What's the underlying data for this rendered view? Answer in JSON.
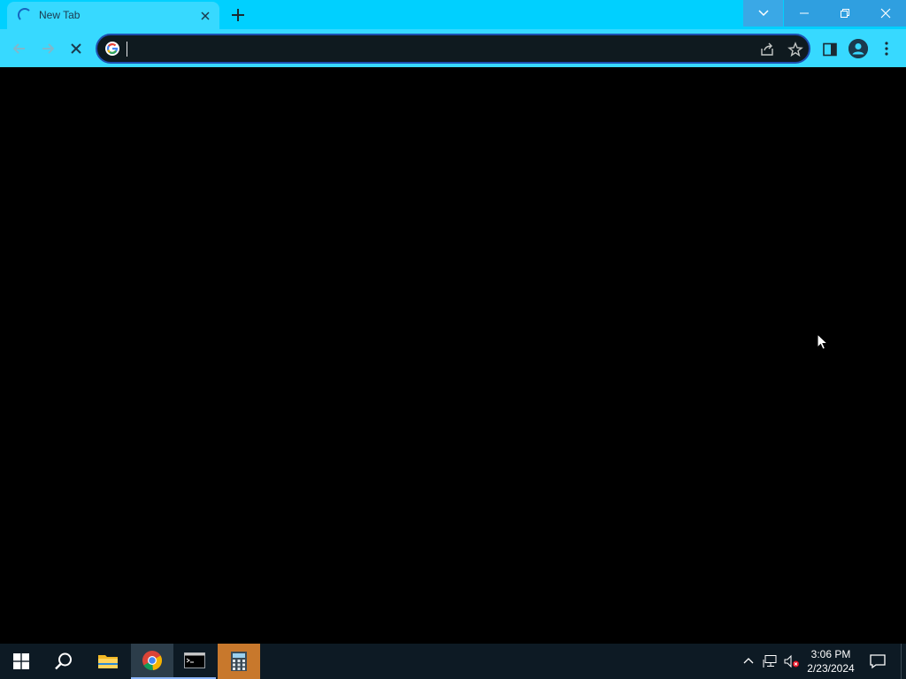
{
  "browser": {
    "tab": {
      "title": "New Tab"
    },
    "omnibox": {
      "value": "",
      "placeholder": ""
    }
  },
  "taskbar": {
    "clock": {
      "time": "3:06 PM",
      "date": "2/23/2024"
    }
  },
  "colors": {
    "titlebar": "#00d0ff",
    "toolbar": "#37d9ff",
    "omnibox_bg": "#0f1a1f",
    "omnibox_border": "#1e4fb0",
    "taskbar": "#0d1a24",
    "content": "#000000"
  },
  "icons": [
    "loading-spinner-icon",
    "close-icon",
    "plus-icon",
    "chevron-down-icon",
    "minimize-icon",
    "restore-icon",
    "close-window-icon",
    "back-arrow-icon",
    "forward-arrow-icon",
    "stop-icon",
    "google-icon",
    "share-icon",
    "star-icon",
    "side-panel-icon",
    "profile-icon",
    "kebab-menu-icon",
    "windows-start-icon",
    "search-icon",
    "file-explorer-icon",
    "chrome-icon",
    "terminal-icon",
    "calculator-icon",
    "chevron-up-icon",
    "network-icon",
    "volume-muted-icon",
    "notification-icon",
    "mouse-cursor-icon"
  ]
}
